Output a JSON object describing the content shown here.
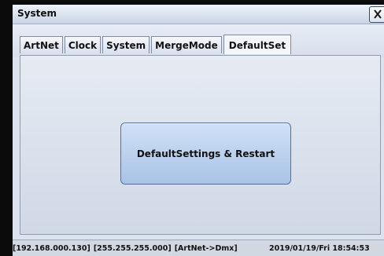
{
  "window": {
    "title": "System"
  },
  "icons": {
    "close": "close-icon"
  },
  "tabs": [
    {
      "label": "ArtNet"
    },
    {
      "label": "Clock"
    },
    {
      "label": "System"
    },
    {
      "label": "MergeMode"
    },
    {
      "label": "DefaultSet",
      "active": true
    }
  ],
  "main": {
    "button_label": "DefaultSettings & Restart"
  },
  "status": {
    "ip": "[192.168.000.130]",
    "mask": "[255.255.255.000]",
    "mode": "[ArtNet->Dmx]",
    "datetime": "2019/01/19/Fri  18:54:53"
  },
  "colors": {
    "screen_bg": "#dde3ee",
    "button_fill": "#b9d0ee",
    "button_border": "#4f72ad"
  }
}
